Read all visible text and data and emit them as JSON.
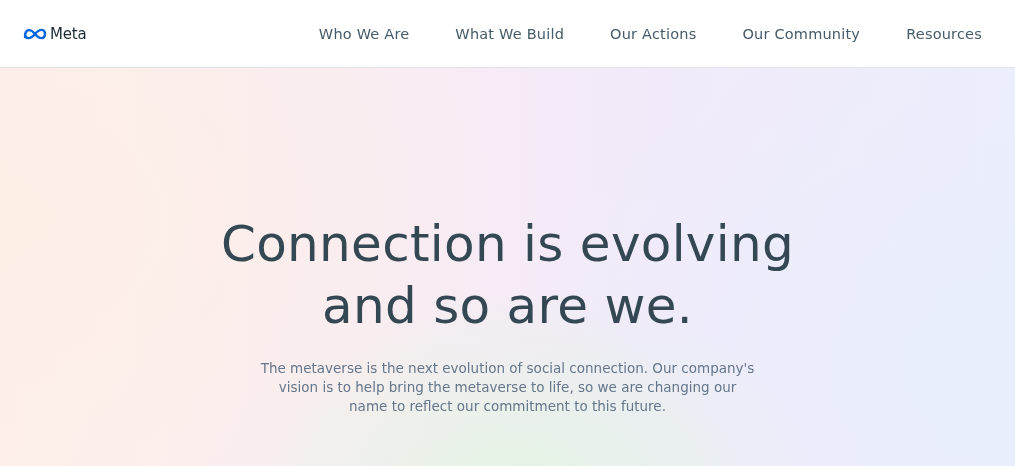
{
  "header": {
    "logo": {
      "text": "Meta"
    },
    "nav": [
      {
        "label": "Who We Are"
      },
      {
        "label": "What We Build"
      },
      {
        "label": "Our Actions"
      },
      {
        "label": "Our Community"
      },
      {
        "label": "Resources"
      }
    ]
  },
  "hero": {
    "heading_lines": [
      "Connection is evolving",
      "and so are we."
    ],
    "body": "The metaverse is the next evolution of social connection. Our company's vision is to help bring the metaverse to life, so we are changing our name to reflect our commitment to this future."
  }
}
